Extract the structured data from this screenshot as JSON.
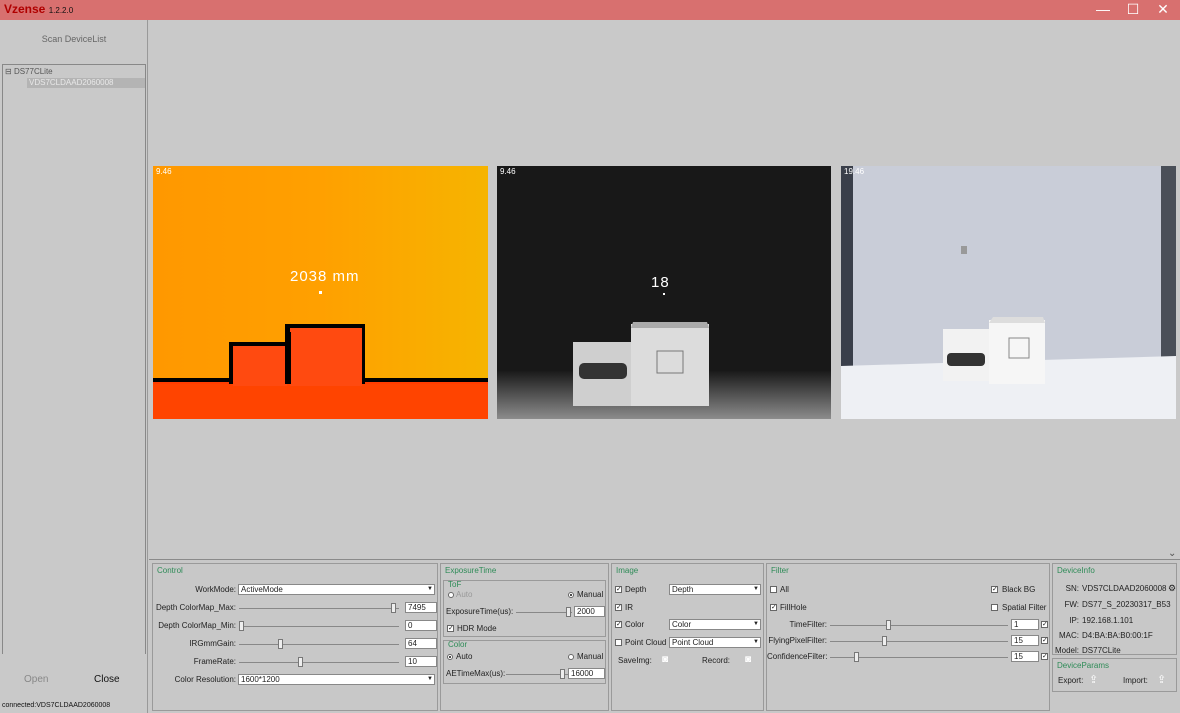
{
  "window": {
    "brand": "Vzense",
    "version": "1.2.2.0",
    "minimize": "—",
    "maximize": "☐",
    "close": "✕"
  },
  "left": {
    "scan_label": "Scan DeviceList",
    "tree_root": "DS77CLite",
    "tree_child": "VDS7CLDAAD2060008",
    "open_label": "Open",
    "close_label": "Close",
    "status": "connected:VDS7CLDAAD2060008"
  },
  "views": {
    "depth": {
      "fps": "9.46",
      "distance": "2038 mm"
    },
    "ir": {
      "fps": "9.46",
      "value": "18"
    },
    "color": {
      "fps": "19.46"
    }
  },
  "control": {
    "title": "Control",
    "workmode_label": "WorkMode:",
    "workmode_value": "ActiveMode",
    "colormap_max_label": "Depth ColorMap_Max:",
    "colormap_max_value": "7495",
    "colormap_min_label": "Depth ColorMap_Min:",
    "colormap_min_value": "0",
    "irgamma_label": "IRGmmGain:",
    "irgamma_value": "64",
    "framerate_label": "FrameRate:",
    "framerate_value": "10",
    "color_res_label": "Color Resolution:",
    "color_res_value": "1600*1200",
    "slider_levels": {
      "colormap_max": 0.98,
      "colormap_min": 0.0,
      "irgamma": 0.25,
      "framerate": 0.38
    }
  },
  "exposure": {
    "title": "ExposureTime",
    "tof_title": "ToF",
    "tof_auto": "Auto",
    "tof_manual": "Manual",
    "exposure_label": "ExposureTime(us):",
    "exposure_value": "2000",
    "hdr_label": "HDR Mode",
    "color_title": "Color",
    "color_auto": "Auto",
    "color_manual": "Manual",
    "ae_label": "AETimeMax(us):",
    "ae_value": "16000"
  },
  "image": {
    "title": "Image",
    "depth_label": "Depth",
    "depth_value": "Depth",
    "ir_label": "IR",
    "color_label": "Color",
    "color_value": "Color",
    "pc_label": "Point Cloud",
    "pc_value": "Point Cloud",
    "saveimg_label": "SaveImg:",
    "record_label": "Record:"
  },
  "filter": {
    "title": "Filter",
    "all_label": "All",
    "blackbg_label": "Black BG",
    "fillhole_label": "FillHole",
    "spatial_label": "Spatial Filter",
    "time_label": "TimeFilter:",
    "time_value": "1",
    "flying_label": "FlyingPixelFilter:",
    "flying_value": "15",
    "confidence_label": "ConfidenceFilter:",
    "confidence_value": "15"
  },
  "device": {
    "title": "DeviceInfo",
    "sn_label": "SN:",
    "sn_value": "VDS7CLDAAD2060008",
    "fw_label": "FW:",
    "fw_value": "DS77_S_20230317_B53",
    "ip_label": "IP:",
    "ip_value": "192.168.1.101",
    "mac_label": "MAC:",
    "mac_value": "D4:BA:BA:B0:00:1F",
    "model_label": "Model:",
    "model_value": "DS77CLite",
    "params_title": "DeviceParams",
    "export_label": "Export:",
    "import_label": "Import:"
  }
}
